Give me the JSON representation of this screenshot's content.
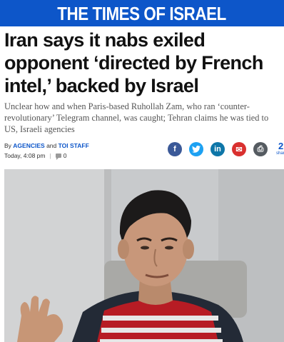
{
  "masthead": {
    "title": "THE TIMES OF ISRAEL"
  },
  "article": {
    "headline": "Iran says it nabs exiled opponent ‘directed by French intel,’ backed by Israel",
    "subhead": "Unclear how and when Paris-based Ruhollah Zam, who ran ‘counter-revolutionary’ Telegram channel, was caught; Tehran claims he was tied to US, Israeli agencies",
    "byline_prefix": "By",
    "byline_source1": "AGENCIES",
    "byline_and": "and",
    "byline_source2": "TOI STAFF",
    "timestamp": "Today, 4:08 pm",
    "comment_count": "0"
  },
  "share": {
    "facebook": "f",
    "twitter": "t",
    "linkedin": "in",
    "email": "✉",
    "print": "⎙",
    "count": "2",
    "count_label": "shar"
  },
  "colors": {
    "brand_blue": "#0d56c9",
    "facebook": "#3b5998",
    "twitter": "#1da1f2",
    "linkedin": "#0e76a8",
    "email": "#d9302f",
    "print": "#555b61"
  },
  "icons": [
    "comment-icon",
    "facebook-icon",
    "twitter-icon",
    "linkedin-icon",
    "email-icon",
    "print-icon"
  ]
}
